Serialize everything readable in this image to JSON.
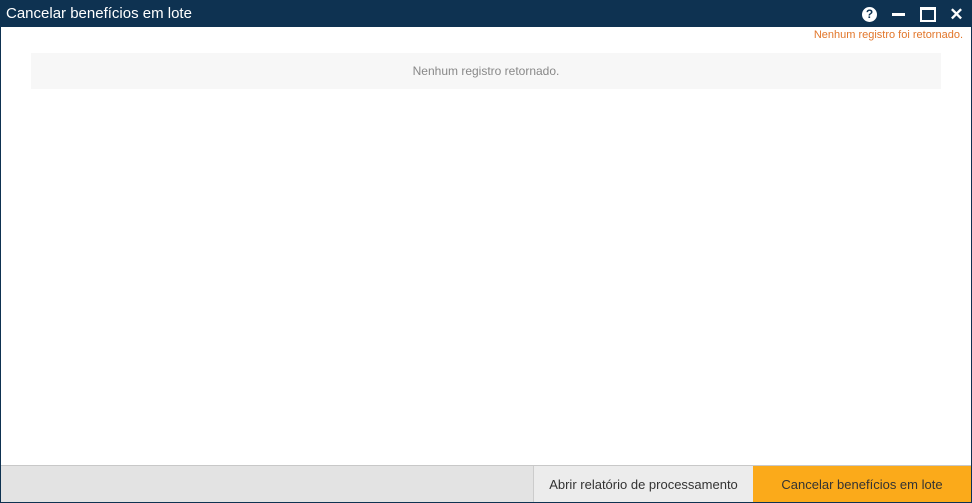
{
  "window": {
    "title": "Cancelar benefícios em lote",
    "controls": {
      "help_glyph": "?",
      "close_glyph": "✕"
    }
  },
  "status": {
    "message": "Nenhum registro foi retornado."
  },
  "results": {
    "empty_text": "Nenhum registro retornado."
  },
  "footer": {
    "report_button_label": "Abrir relatório de processamento",
    "cancel_button_label": "Cancelar benefícios em lote"
  },
  "colors": {
    "titlebar": "#0e3251",
    "status_message": "#e2762a",
    "primary_button": "#fbaa1a"
  },
  "icons": {
    "help": "help-icon",
    "minimize": "minimize-icon",
    "maximize": "maximize-icon",
    "close": "close-icon"
  }
}
